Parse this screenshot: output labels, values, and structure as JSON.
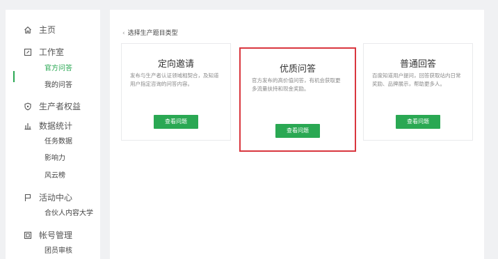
{
  "sidebar": {
    "home": {
      "label": "主页",
      "icon": "home-icon"
    },
    "studio": {
      "label": "工作室",
      "icon": "edit-icon",
      "items": [
        "官方问答",
        "我的问答"
      ],
      "active": "官方问答"
    },
    "rights": {
      "label": "生产者权益",
      "icon": "shield-icon"
    },
    "stats": {
      "label": "数据统计",
      "icon": "bar-chart-icon",
      "items": [
        "任务数据",
        "影响力",
        "风云榜"
      ]
    },
    "activity": {
      "label": "活动中心",
      "icon": "flag-icon",
      "items": [
        "合伙人内容大学"
      ]
    },
    "account": {
      "label": "帐号管理",
      "icon": "account-icon",
      "items": [
        "团员审核"
      ]
    }
  },
  "main": {
    "breadcrumb": "选择生产题目类型",
    "cards": [
      {
        "title": "定向邀请",
        "desc": "发布与生产者认证领域相契合，及知道用户指定咨询的问答内容。",
        "button": "查看问题"
      },
      {
        "title": "优质问答",
        "desc": "官方发布的高价值问答，有机会获取更多流量扶持和现金奖励。",
        "button": "查看问题"
      },
      {
        "title": "普通回答",
        "desc": "百度知道用户提问，回答获取站内日常奖励、品牌展示，帮助更多人。",
        "button": "查看问题"
      }
    ]
  },
  "colors": {
    "accent": "#2aa853",
    "highlight_border": "#d9363e"
  }
}
